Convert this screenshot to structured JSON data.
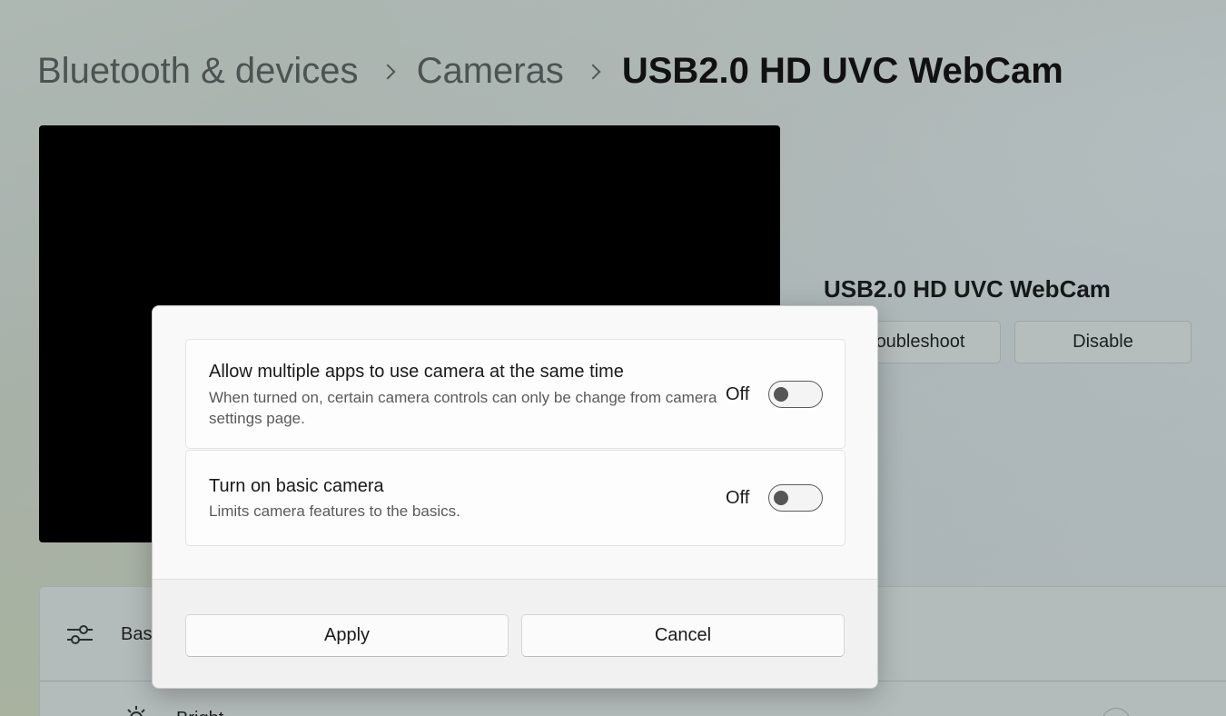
{
  "breadcrumb": {
    "items": [
      "Bluetooth & devices",
      "Cameras"
    ],
    "current": "USB2.0 HD UVC WebCam"
  },
  "device": {
    "name": "USB2.0 HD UVC WebCam",
    "troubleshoot_label": "oubleshoot",
    "disable_label": "Disable"
  },
  "background_settings": {
    "row1_label": "Basi",
    "row1_icon": "sliders-icon",
    "row2_label": "Bright",
    "row2_icon": "sun-icon"
  },
  "dialog": {
    "options": [
      {
        "title": "Allow multiple apps to use camera at the same time",
        "description": "When turned on, certain camera controls can only be change from camera settings page.",
        "state_label": "Off",
        "checked": false
      },
      {
        "title": "Turn on basic camera",
        "description": "Limits camera features to the basics.",
        "state_label": "Off",
        "checked": false
      }
    ],
    "apply_label": "Apply",
    "cancel_label": "Cancel"
  },
  "colors": {
    "dialog_bg": "#f9f9f9",
    "footer_bg": "#f1f1f1",
    "preview_bg": "#000000"
  }
}
